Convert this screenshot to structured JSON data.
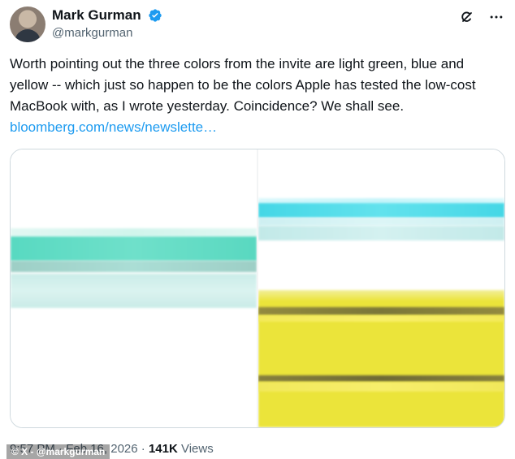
{
  "author": {
    "display_name": "Mark Gurman",
    "handle": "@markgurman",
    "verified": true,
    "verified_color": "#1d9bf0"
  },
  "actions": {
    "grok_icon": "grok-icon",
    "more_icon": "more-icon"
  },
  "tweet": {
    "text": "Worth pointing out the three colors from the invite are light green, blue and yellow -- which just so happen to be the colors Apple has tested the low-cost MacBook with, as I wrote yesterday. Coincidence? We shall see. ",
    "link_text": "bloomberg.com/news/newslette…",
    "link_color": "#1d9bf0"
  },
  "media": {
    "colors": {
      "green": "#59d8c0",
      "blue": "#45d7e6",
      "yellow": "#ebe43a"
    }
  },
  "meta": {
    "time_date": "9:57 PM · Feb 16, 2026 · ",
    "views_count": "141K",
    "views_label": " Views",
    "watermark": "© X - @markgurman"
  }
}
